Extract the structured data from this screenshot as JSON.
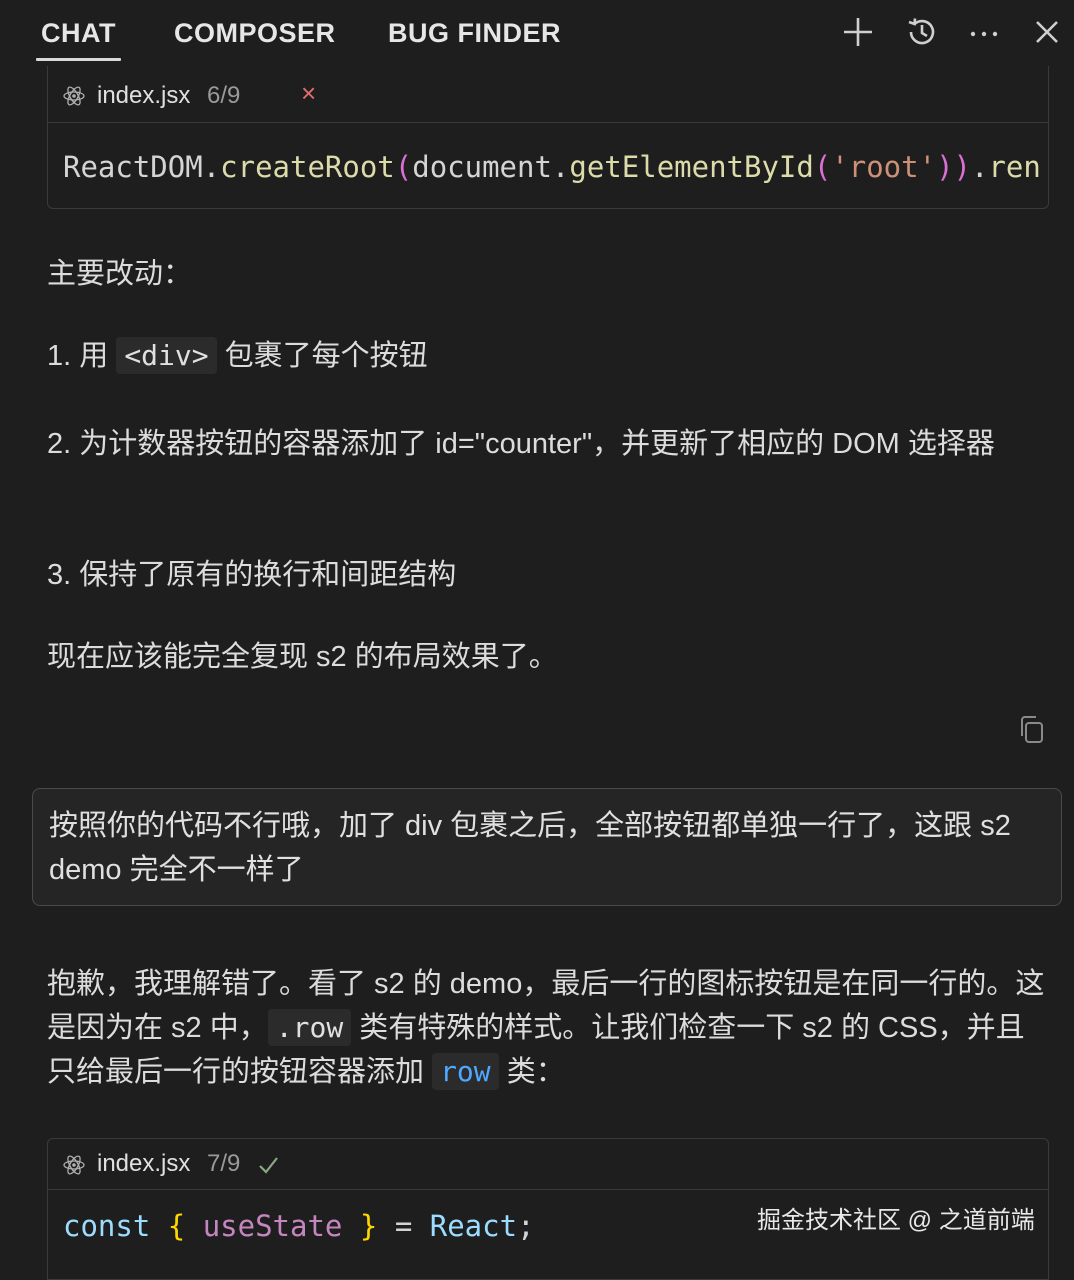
{
  "tabs": {
    "chat": "CHAT",
    "composer": "COMPOSER",
    "bug_finder": "BUG FINDER"
  },
  "toolbar_icons": [
    "plus-icon",
    "history-icon",
    "more-icon",
    "close-icon"
  ],
  "code_block_1": {
    "file_name": "index.jsx",
    "count": "6/9",
    "status_icon": "×",
    "code": {
      "ident1": "ReactDOM",
      "dot1": ".",
      "fn1": "createRoot",
      "open1": "(",
      "ident2": "document",
      "dot2": ".",
      "fn2": "getElementById",
      "open2": "(",
      "str": "'root'",
      "close2": ")",
      "close1": ")",
      "dot3": ".",
      "fn3": "ren"
    }
  },
  "assistant_1": {
    "heading": "主要改动：",
    "item1_prefix": "1. 用 ",
    "item1_code": "<div>",
    "item1_suffix": " 包裹了每个按钮",
    "item2": "2. 为计数器按钮的容器添加了 id=\"counter\"，并更新了相应的 DOM 选择器",
    "item3": "3. 保持了原有的换行和间距结构",
    "closing": "现在应该能完全复现 s2 的布局效果了。"
  },
  "user_message": "按照你的代码不行哦，加了 div 包裹之后，全部按钮都单独一行了，这跟 s2 demo 完全不一样了",
  "assistant_2": {
    "part1": "抱歉，我理解错了。看了 s2 的 demo，最后一行的图标按钮是在同一行的。这是因为在 s2 中，",
    "code1": ".row",
    "part2": " 类有特殊的样式。让我们检查一下 s2 的 CSS，并且只给最后一行的按钮容器添加 ",
    "code2": "row",
    "part3": " 类："
  },
  "code_block_2": {
    "file_name": "index.jsx",
    "count": "7/9",
    "code": {
      "kw": "const",
      "lbrace": "{",
      "var": "useState",
      "rbrace": "}",
      "eq": "=",
      "cls": "React",
      "semi": ";"
    }
  },
  "watermark": "掘金技术社区 @ 之道前端",
  "colors": {
    "background": "#1e1e1e",
    "border": "#3a3a3a",
    "error_red": "#e06c6c",
    "success_green": "#6a9955",
    "inline_code_blue": "#4fa8ff"
  }
}
